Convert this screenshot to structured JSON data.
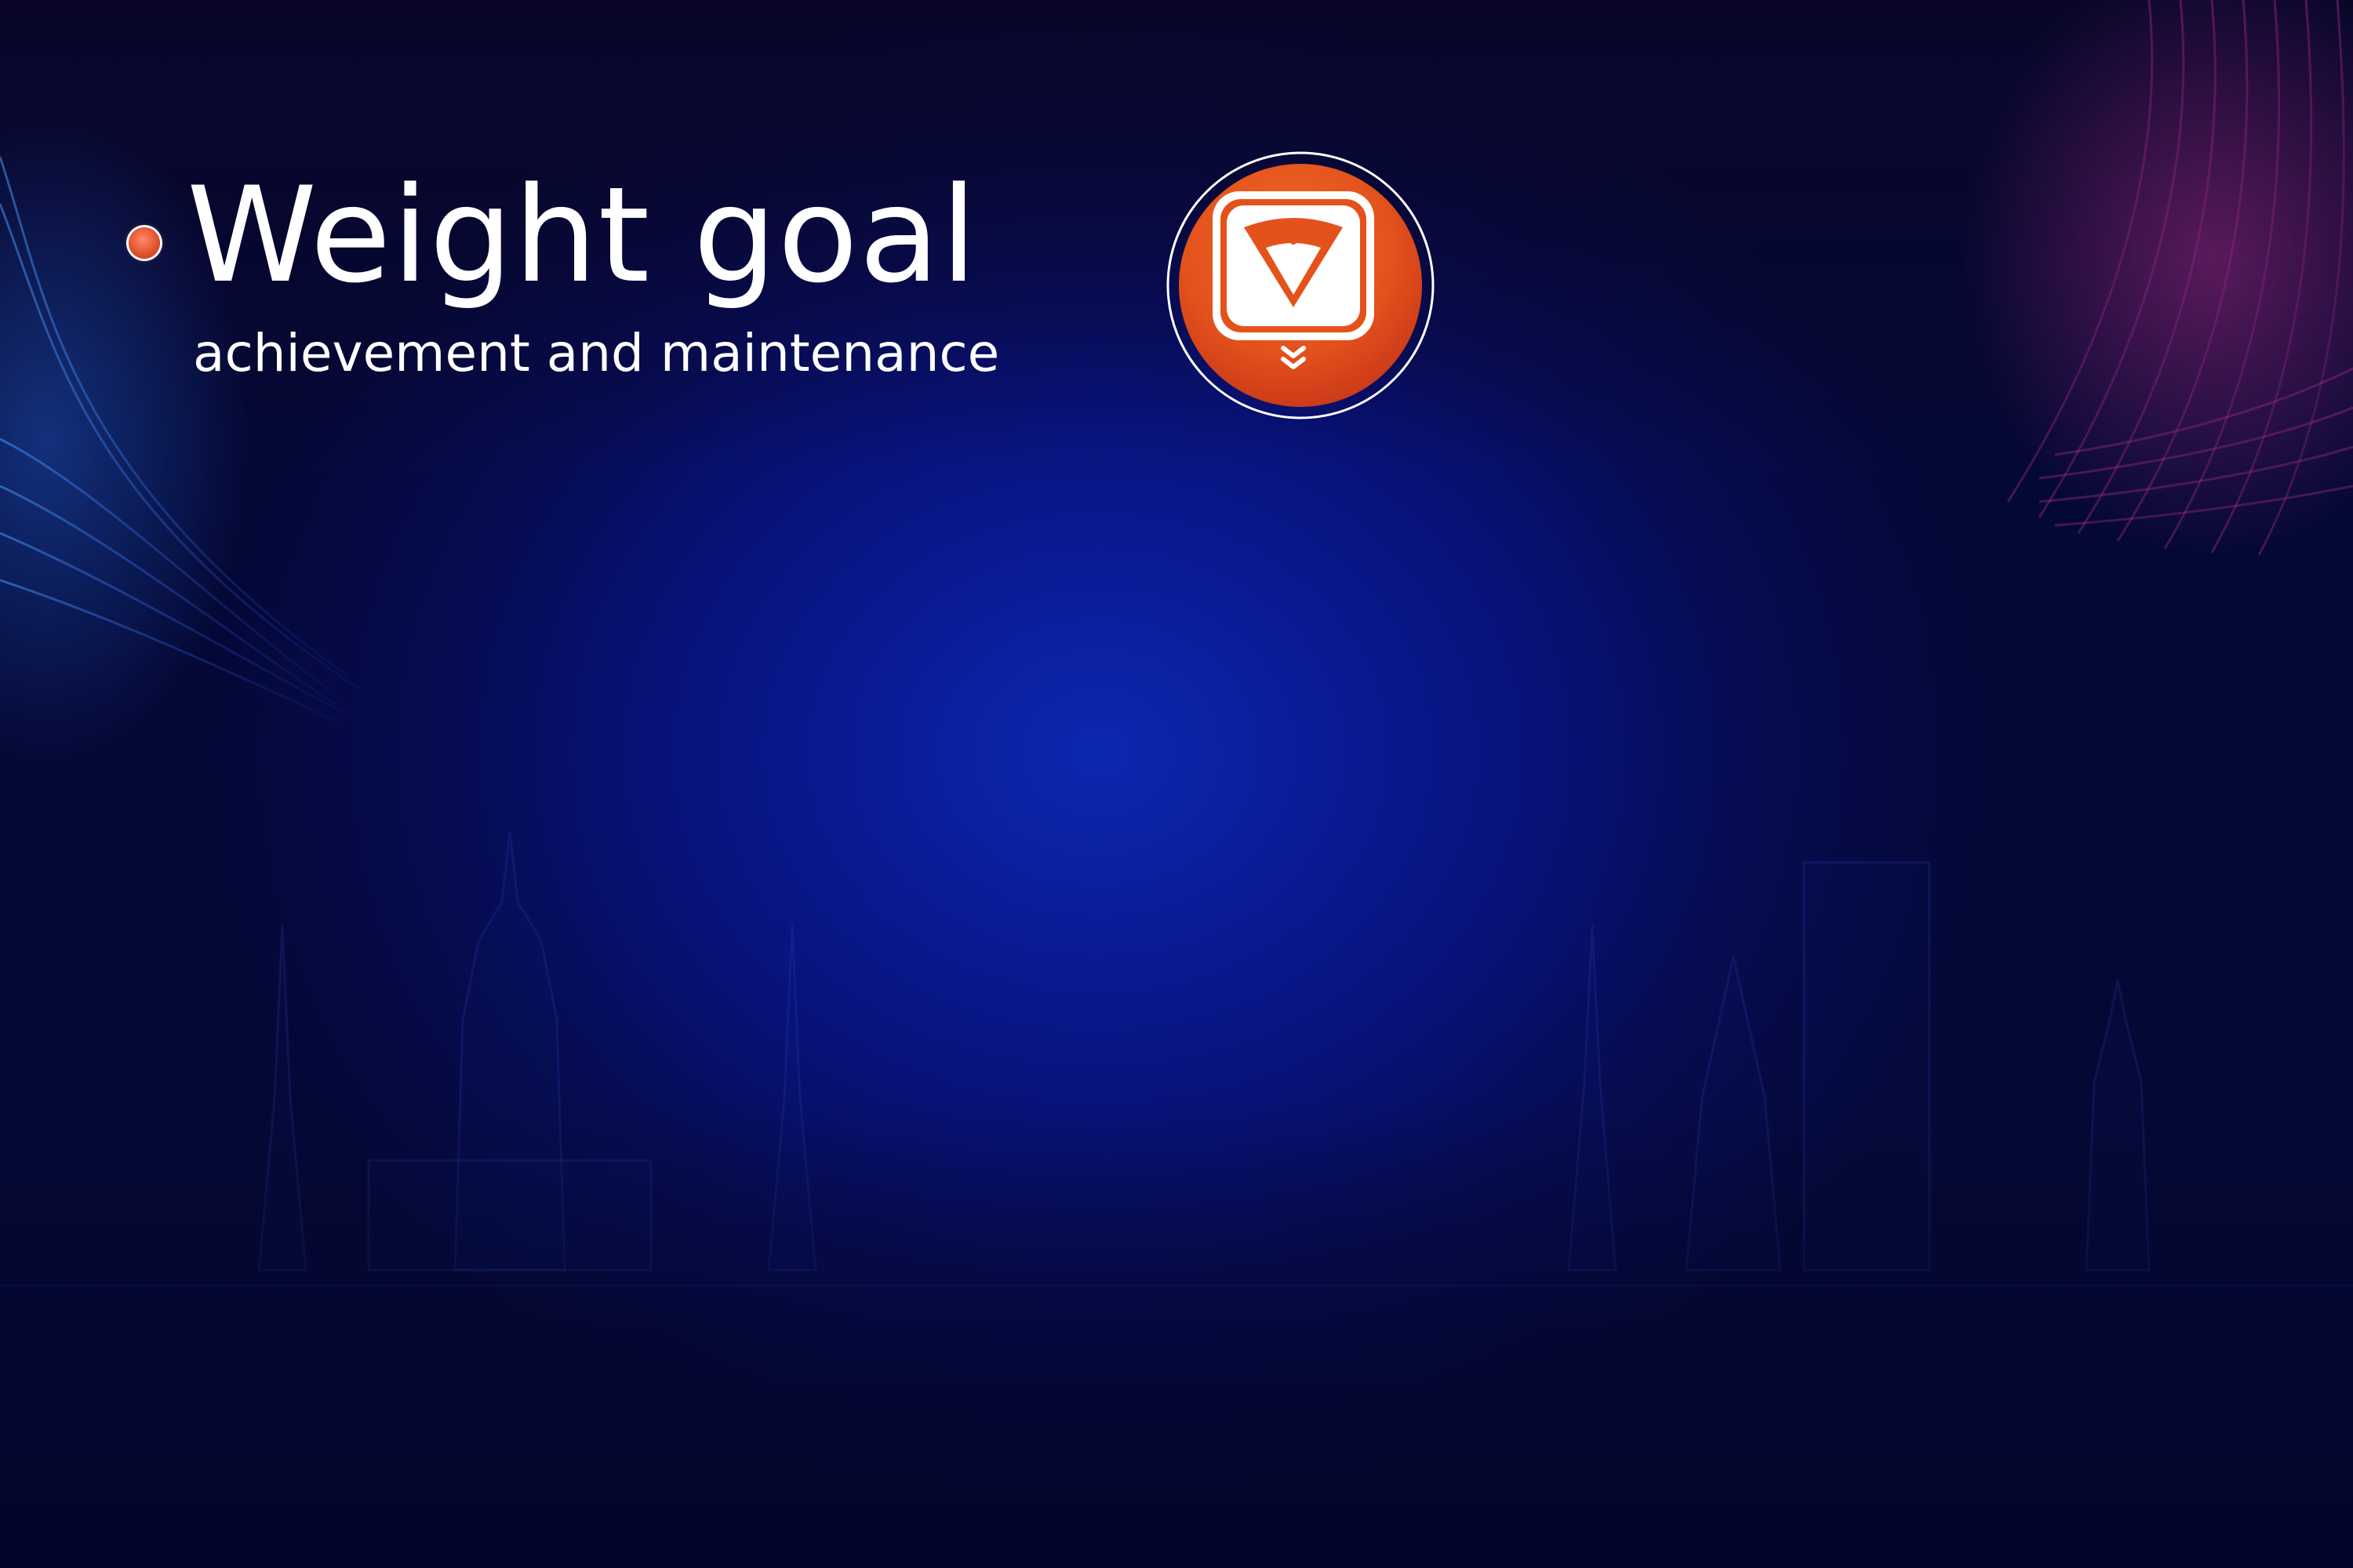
{
  "slide": {
    "title": "Weight goal",
    "subtitle": "achievement and maintenance"
  },
  "icon": {
    "name": "weighing-scale-icon",
    "badge_color": "#e4521c",
    "ring_color": "#ffffff"
  },
  "colors": {
    "background_center": "#0b28b0",
    "background_edge": "#040835",
    "accent_pink": "#c03090",
    "accent_blue": "#3a7aff",
    "text": "#ffffff"
  }
}
